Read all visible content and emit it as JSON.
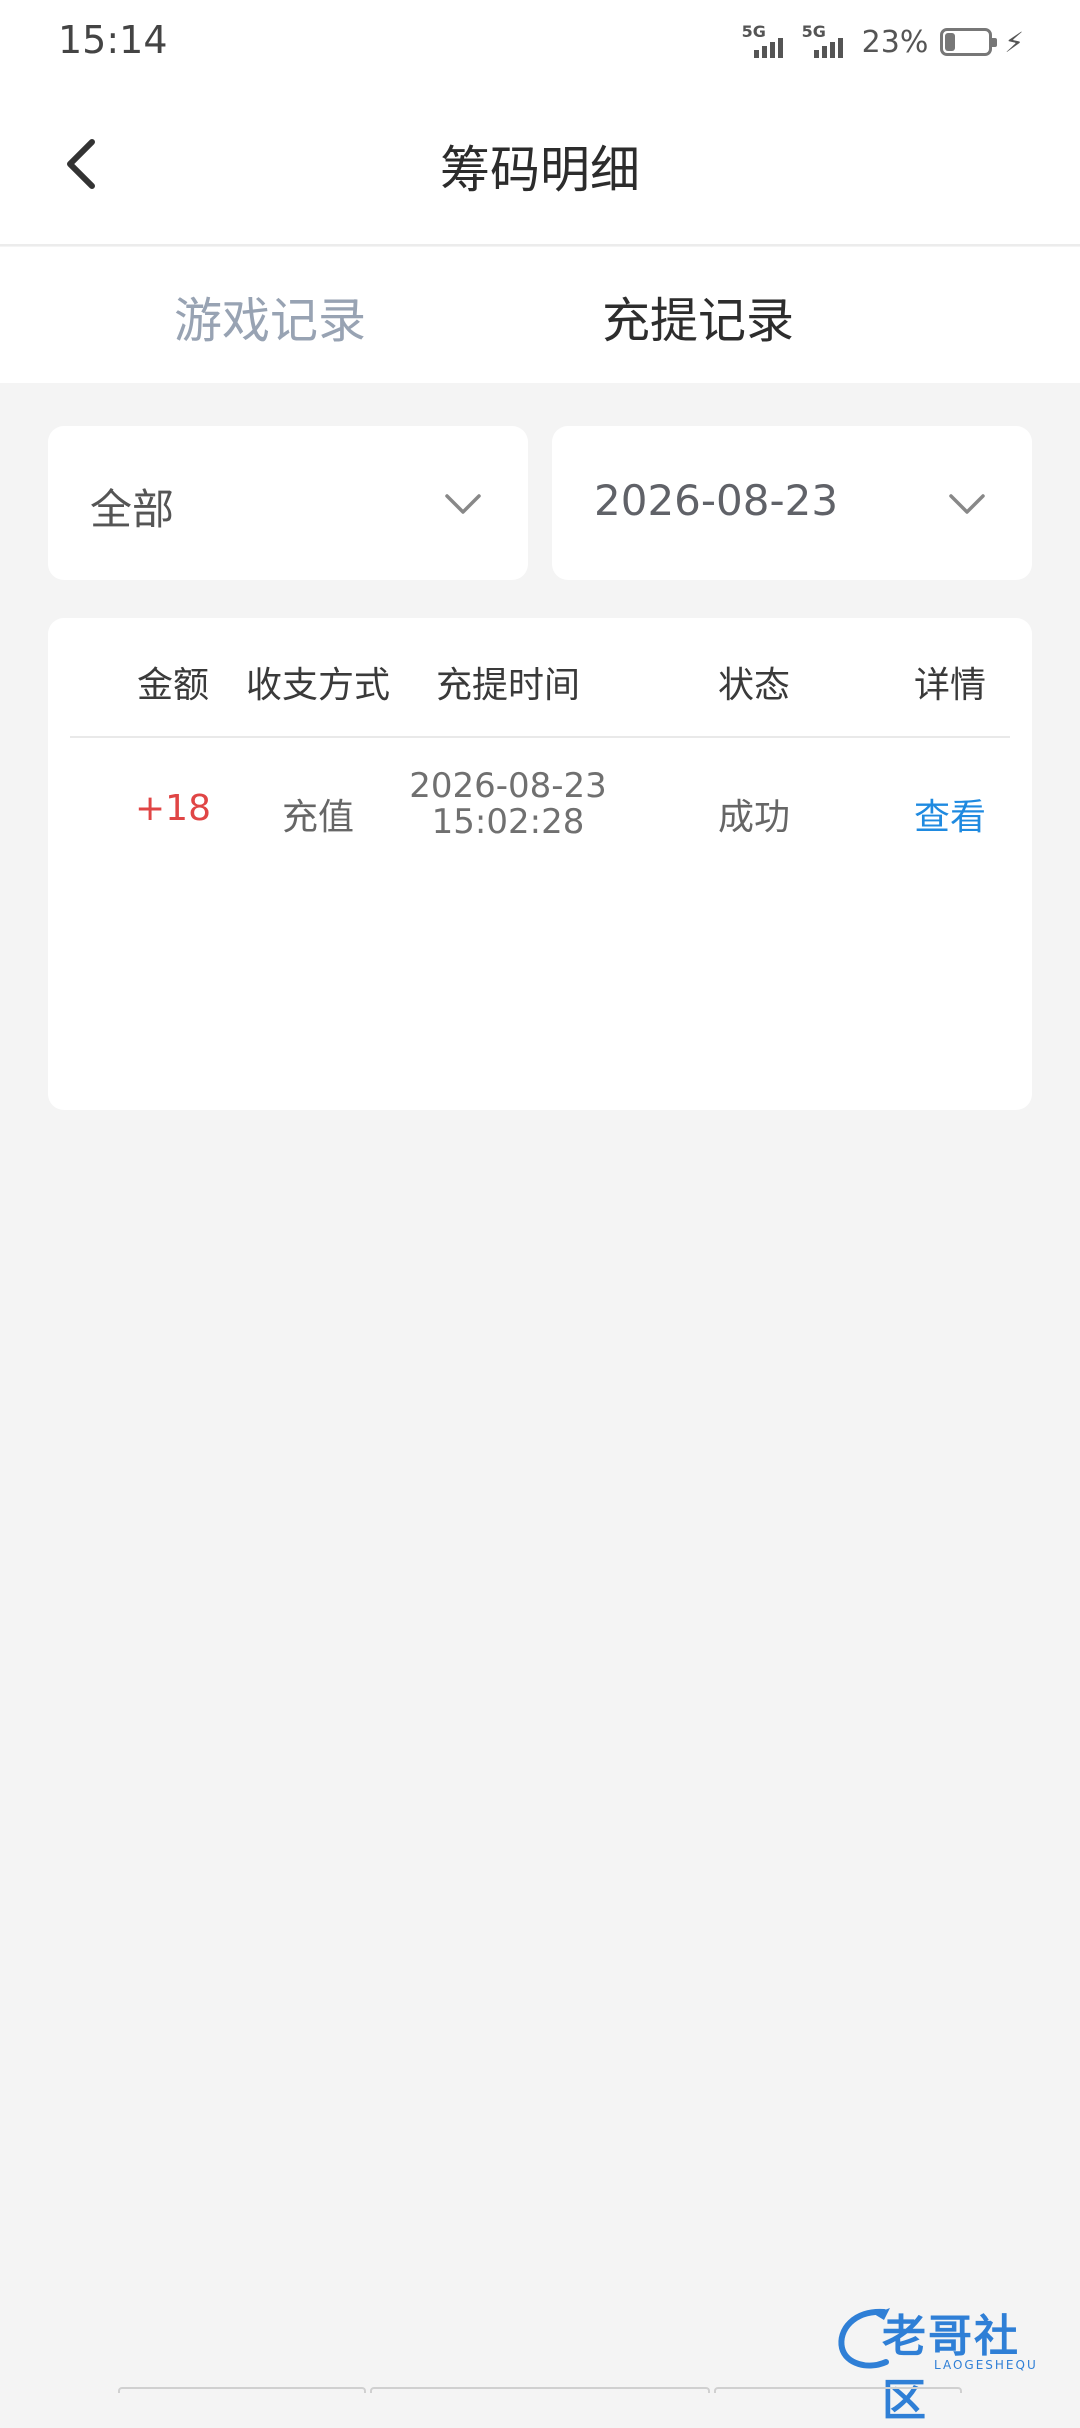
{
  "status_bar": {
    "time": "15:14",
    "signal1_label": "5G",
    "signal2_label": "5G",
    "battery_percent": "23%",
    "battery_level": 0.23
  },
  "navbar": {
    "title": "筹码明细",
    "back_icon": "chevron-left-icon"
  },
  "tabs": [
    {
      "label": "游戏记录",
      "active": false
    },
    {
      "label": "充提记录",
      "active": true
    }
  ],
  "filters": {
    "type_value": "全部",
    "date_value": "2026-08-23",
    "chevron_icon": "chevron-down-icon"
  },
  "table": {
    "headers": [
      "金额",
      "收支方式",
      "充提时间",
      "状态",
      "详情"
    ],
    "rows": [
      {
        "amount": "+18",
        "method": "充值",
        "date": "2026-08-23",
        "time": "15:02:28",
        "status": "成功",
        "detail": "查看"
      }
    ]
  },
  "watermark": {
    "text": "老哥社区",
    "sub": "LAOGESHEQU"
  },
  "colors": {
    "amount_positive": "#e04545",
    "link": "#1f8ae0",
    "tab_inactive": "#98a3b3",
    "background": "#f4f4f4"
  }
}
